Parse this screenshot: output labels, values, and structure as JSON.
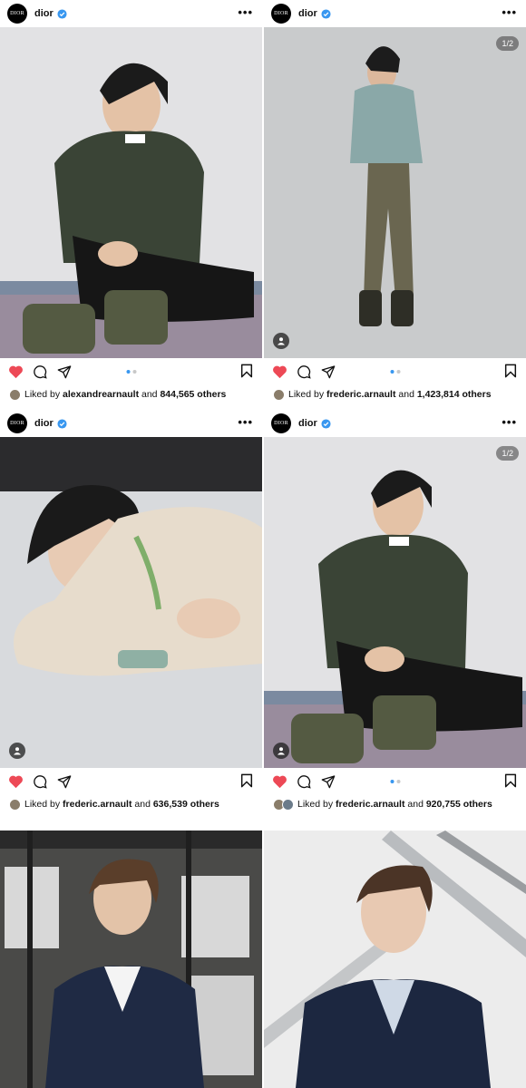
{
  "brand": {
    "logo_text": "DIOR",
    "username": "dior"
  },
  "more_label": "•••",
  "posts": [
    {
      "counter": "",
      "liker": "alexandrearnault",
      "and_word": " and ",
      "count": "844,565 others",
      "liked_by": "Liked by "
    },
    {
      "counter": "1/2",
      "liker": "frederic.arnault",
      "and_word": " and ",
      "count": "1,423,814 others",
      "liked_by": "Liked by "
    },
    {
      "counter": "",
      "liker": "frederic.arnault",
      "and_word": " and ",
      "count": "636,539 others",
      "liked_by": "Liked by "
    },
    {
      "counter": "1/2",
      "liker": "frederic.arnault",
      "and_word": " and ",
      "count": "920,755 others",
      "liked_by": "Liked by "
    }
  ],
  "colors": {
    "like_red": "#ed4956",
    "verified_blue": "#3897f0",
    "dot_active": "#3897f0"
  },
  "icons": [
    "heart-icon",
    "comment-icon",
    "share-icon",
    "bookmark-icon",
    "verified-icon",
    "tag-person-icon",
    "more-icon"
  ]
}
